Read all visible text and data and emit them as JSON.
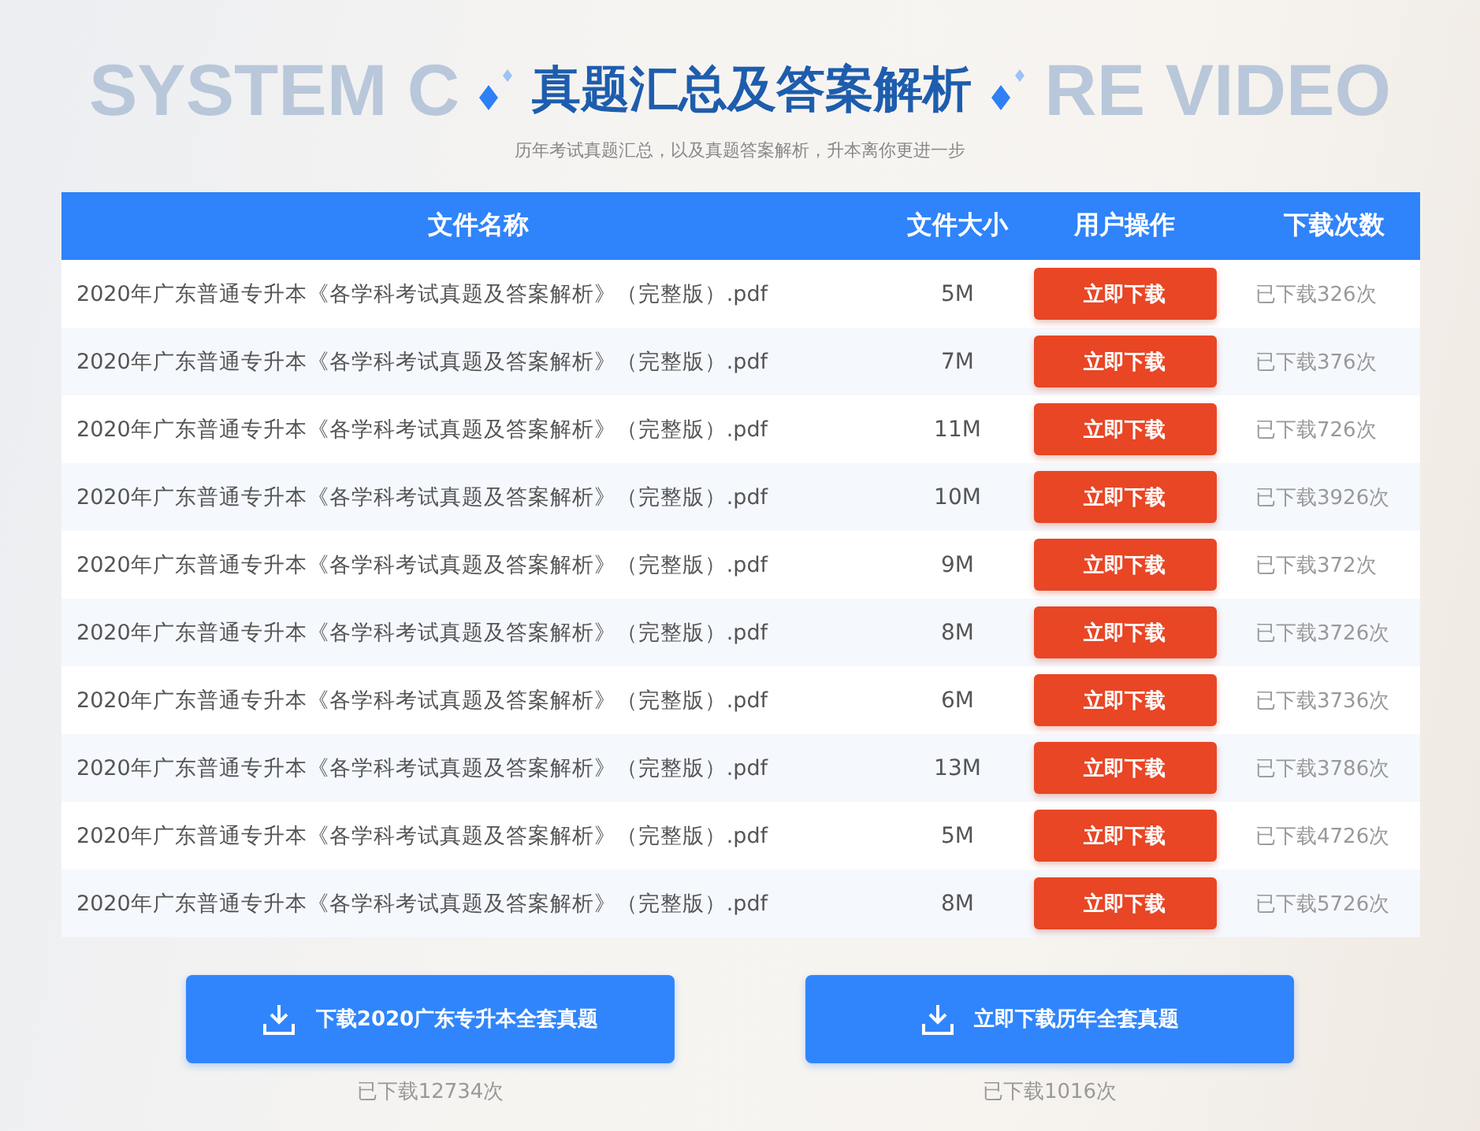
{
  "backdrop_words": [
    "SYSTEM C",
    "RE VIDEO"
  ],
  "title": "真题汇总及答案解析",
  "subtitle": "历年考试真题汇总，以及真题答案解析，升本离你更进一步",
  "table": {
    "columns": [
      "文件名称",
      "文件大小",
      "用户操作",
      "下载次数"
    ],
    "rows": [
      {
        "name": "2020年广东普通专升本《各学科考试真题及答案解析》（完整版）.pdf",
        "size": "5M",
        "action": "立即下载",
        "downloads": "已下载326次"
      },
      {
        "name": "2020年广东普通专升本《各学科考试真题及答案解析》（完整版）.pdf",
        "size": "7M",
        "action": "立即下载",
        "downloads": "已下载376次"
      },
      {
        "name": "2020年广东普通专升本《各学科考试真题及答案解析》（完整版）.pdf",
        "size": "11M",
        "action": "立即下载",
        "downloads": "已下载726次"
      },
      {
        "name": "2020年广东普通专升本《各学科考试真题及答案解析》（完整版）.pdf",
        "size": "10M",
        "action": "立即下载",
        "downloads": "已下载3926次"
      },
      {
        "name": "2020年广东普通专升本《各学科考试真题及答案解析》（完整版）.pdf",
        "size": "9M",
        "action": "立即下载",
        "downloads": "已下载372次"
      },
      {
        "name": "2020年广东普通专升本《各学科考试真题及答案解析》（完整版）.pdf",
        "size": "8M",
        "action": "立即下载",
        "downloads": "已下载3726次"
      },
      {
        "name": "2020年广东普通专升本《各学科考试真题及答案解析》（完整版）.pdf",
        "size": "6M",
        "action": "立即下载",
        "downloads": "已下载3736次"
      },
      {
        "name": "2020年广东普通专升本《各学科考试真题及答案解析》（完整版）.pdf",
        "size": "13M",
        "action": "立即下载",
        "downloads": "已下载3786次"
      },
      {
        "name": "2020年广东普通专升本《各学科考试真题及答案解析》（完整版）.pdf",
        "size": "5M",
        "action": "立即下载",
        "downloads": "已下载4726次"
      },
      {
        "name": "2020年广东普通专升本《各学科考试真题及答案解析》（完整版）.pdf",
        "size": "8M",
        "action": "立即下载",
        "downloads": "已下载5726次"
      }
    ]
  },
  "bundles": [
    {
      "label": "下载2020广东专升本全套真题",
      "downloads": "已下载12734次"
    },
    {
      "label": "立即下载历年全套真题",
      "downloads": "已下载1016次"
    }
  ]
}
